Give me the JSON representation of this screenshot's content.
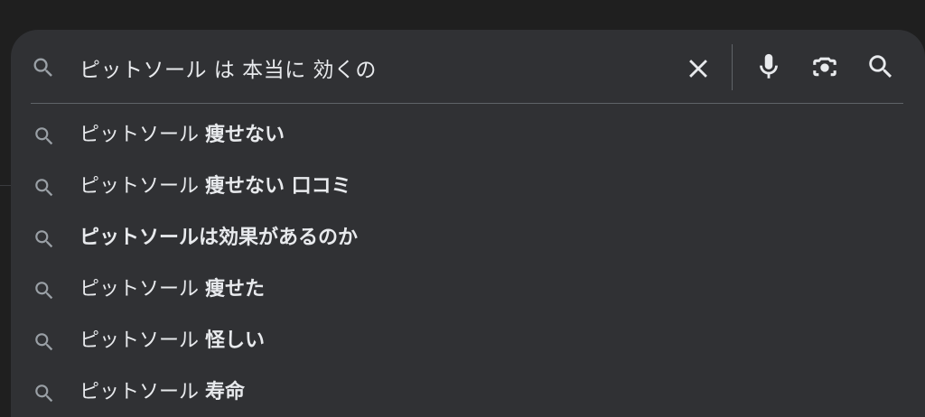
{
  "search": {
    "query": "ピットソール は 本当に 効くの",
    "icons": {
      "search": "search-icon",
      "clear": "close-icon",
      "voice": "microphone-icon",
      "lens": "lens-camera-icon",
      "submit": "search-icon"
    }
  },
  "suggestions": [
    {
      "prefix": "ピットソール ",
      "suffix": "痩せない"
    },
    {
      "prefix": "ピットソール ",
      "suffix": "痩せない 口コミ"
    },
    {
      "prefix": "",
      "suffix": "ピットソールは効果があるのか"
    },
    {
      "prefix": "ピットソール ",
      "suffix": "痩せた"
    },
    {
      "prefix": "ピットソール ",
      "suffix": "怪しい"
    },
    {
      "prefix": "ピットソール ",
      "suffix": "寿命"
    }
  ],
  "colors": {
    "page_background": "#1f1f1f",
    "panel_background": "#303134",
    "text": "#e8eaed",
    "icon": "#9aa0a6",
    "divider": "#5f6368"
  }
}
